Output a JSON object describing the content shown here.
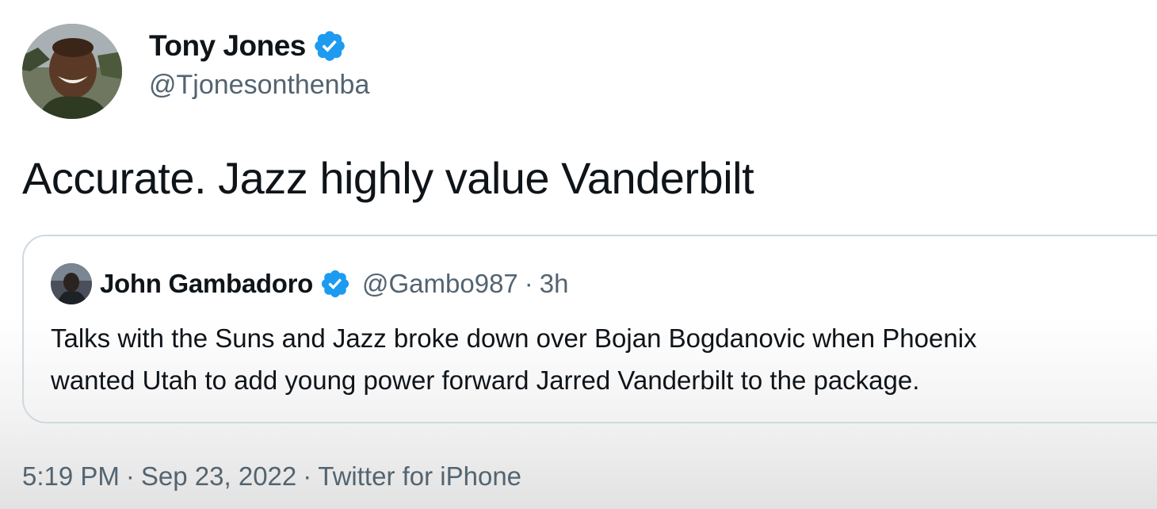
{
  "author": {
    "name": "Tony Jones",
    "handle": "@Tjonesonthenba",
    "verified": true
  },
  "tweet": {
    "text": "Accurate. Jazz highly value Vanderbilt"
  },
  "quote": {
    "name": "John Gambadoro",
    "handle": "@Gambo987",
    "separator": "·",
    "time": "3h",
    "verified": true,
    "body_line1": "Talks with the Suns and Jazz broke down over Bojan Bogdanovic when Phoenix",
    "body_line2": "wanted Utah to add young power forward Jarred Vanderbilt to the package."
  },
  "meta": {
    "time": "5:19 PM",
    "separator": "·",
    "date": "Sep 23, 2022",
    "source": "Twitter for iPhone"
  },
  "colors": {
    "verified": "#1d9bf0",
    "text": "#0f1419",
    "secondary": "#536471",
    "border": "#cfd9de"
  }
}
